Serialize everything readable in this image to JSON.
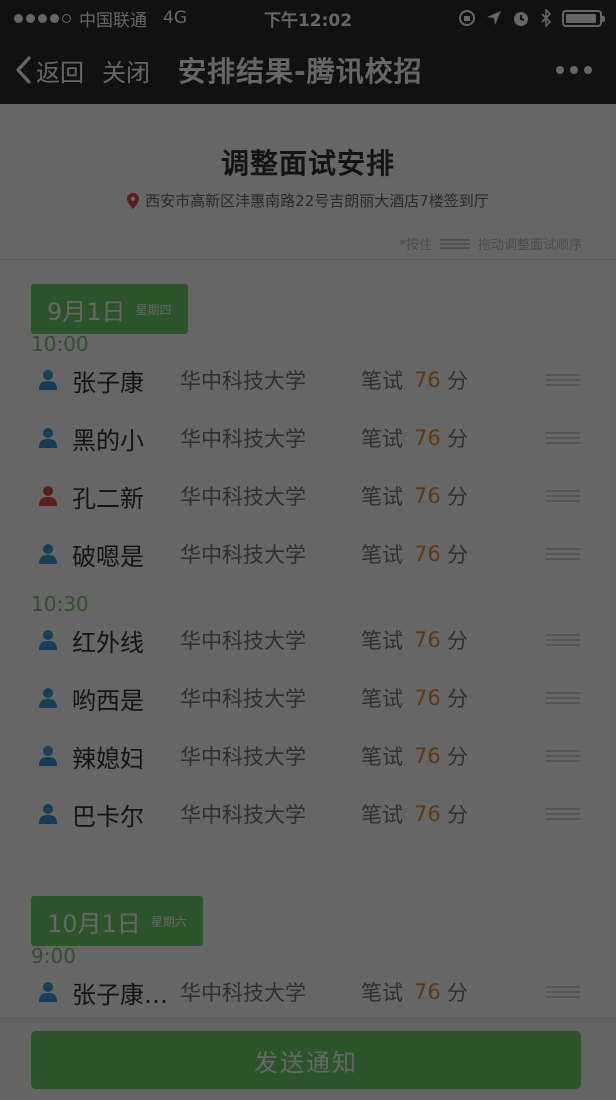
{
  "status_bar": {
    "carrier": "中国联通",
    "network": "4G",
    "time": "下午12:02"
  },
  "nav": {
    "back_label": "返回",
    "close_label": "关闭",
    "title": "安排结果-腾讯校招"
  },
  "page": {
    "title": "调整面试安排",
    "location": "西安市高新区沣惠南路22号吉朗丽大酒店7楼签到厅",
    "hint_prefix": "*按住",
    "hint_suffix": "拖动调整面试顺序"
  },
  "groups": [
    {
      "date": "9月1日",
      "weekday": "星期四",
      "slots": [
        {
          "time": "10:00",
          "candidates": [
            {
              "name": "张子康",
              "school": "华中科技大学",
              "exam_label": "笔试",
              "score": "76",
              "unit": "分",
              "gender": "male"
            },
            {
              "name": "黑的小",
              "school": "华中科技大学",
              "exam_label": "笔试",
              "score": "76",
              "unit": "分",
              "gender": "male"
            },
            {
              "name": "孔二新",
              "school": "华中科技大学",
              "exam_label": "笔试",
              "score": "76",
              "unit": "分",
              "gender": "female"
            },
            {
              "name": "破嗯是",
              "school": "华中科技大学",
              "exam_label": "笔试",
              "score": "76",
              "unit": "分",
              "gender": "male"
            }
          ]
        },
        {
          "time": "10:30",
          "candidates": [
            {
              "name": "红外线",
              "school": "华中科技大学",
              "exam_label": "笔试",
              "score": "76",
              "unit": "分",
              "gender": "male"
            },
            {
              "name": "哟西是",
              "school": "华中科技大学",
              "exam_label": "笔试",
              "score": "76",
              "unit": "分",
              "gender": "male"
            },
            {
              "name": "辣媳妇",
              "school": "华中科技大学",
              "exam_label": "笔试",
              "score": "76",
              "unit": "分",
              "gender": "male"
            },
            {
              "name": "巴卡尔",
              "school": "华中科技大学",
              "exam_label": "笔试",
              "score": "76",
              "unit": "分",
              "gender": "male"
            }
          ]
        }
      ]
    },
    {
      "date": "10月1日",
      "weekday": "星期六",
      "slots": [
        {
          "time": "9:00",
          "candidates": [
            {
              "name": "张子康…",
              "school": "华中科技大学",
              "exam_label": "笔试",
              "score": "76",
              "unit": "分",
              "gender": "male"
            }
          ]
        }
      ]
    }
  ],
  "footer": {
    "send_label": "发送通知"
  },
  "colors": {
    "accent_green": "#6cd36c",
    "score_orange": "#f08a24",
    "male_icon": "#3a9bdc",
    "female_icon": "#e0524a",
    "location_pin": "#e0524a",
    "nav_background": "#2b2b2f"
  }
}
